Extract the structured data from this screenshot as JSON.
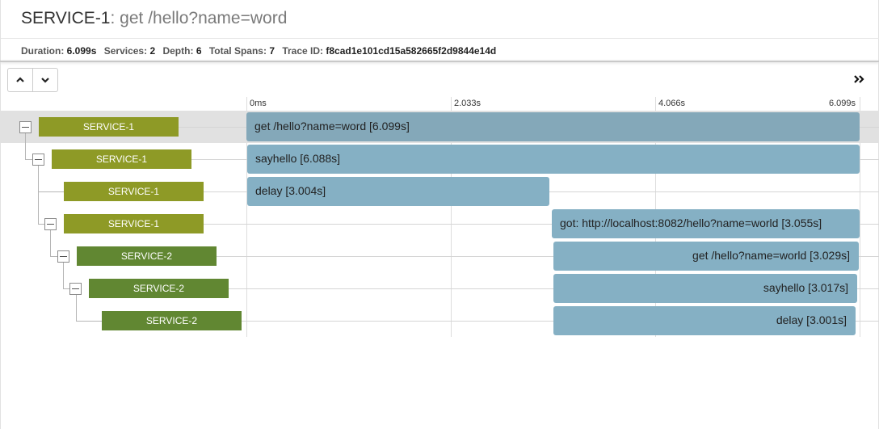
{
  "header": {
    "service": "SERVICE-1",
    "operation": ": get /hello?name=word",
    "duration_label": "Duration:",
    "duration": "6.099s",
    "services_label": "Services:",
    "services": "2",
    "depth_label": "Depth:",
    "depth": "6",
    "total_spans_label": "Total Spans:",
    "total_spans": "7",
    "trace_id_label": "Trace ID:",
    "trace_id": "f8cad1e101cd15a582665f2d9844e14d"
  },
  "toolbar": {
    "up_icon": "chevron-up-icon",
    "down_icon": "chevron-down-icon",
    "expand_icon": "double-chevron-right-icon"
  },
  "timeline": {
    "ticks": [
      "0ms",
      "2.033s",
      "4.066s",
      "6.099s"
    ]
  },
  "colors": {
    "service1": "#8e9a26",
    "service2": "#618732",
    "span": "#85b0c4",
    "selected_row": "#e1e1e1"
  },
  "spans": [
    {
      "service": "SERVICE-1",
      "label": "get /hello?name=word [6.099s]"
    },
    {
      "service": "SERVICE-1",
      "label": "sayhello [6.088s]"
    },
    {
      "service": "SERVICE-1",
      "label": "delay [3.004s]"
    },
    {
      "service": "SERVICE-1",
      "label": "got: http://localhost:8082/hello?name=world [3.055s]"
    },
    {
      "service": "SERVICE-2",
      "label": "get /hello?name=world [3.029s]"
    },
    {
      "service": "SERVICE-2",
      "label": "sayhello [3.017s]"
    },
    {
      "service": "SERVICE-2",
      "label": "delay [3.001s]"
    }
  ]
}
